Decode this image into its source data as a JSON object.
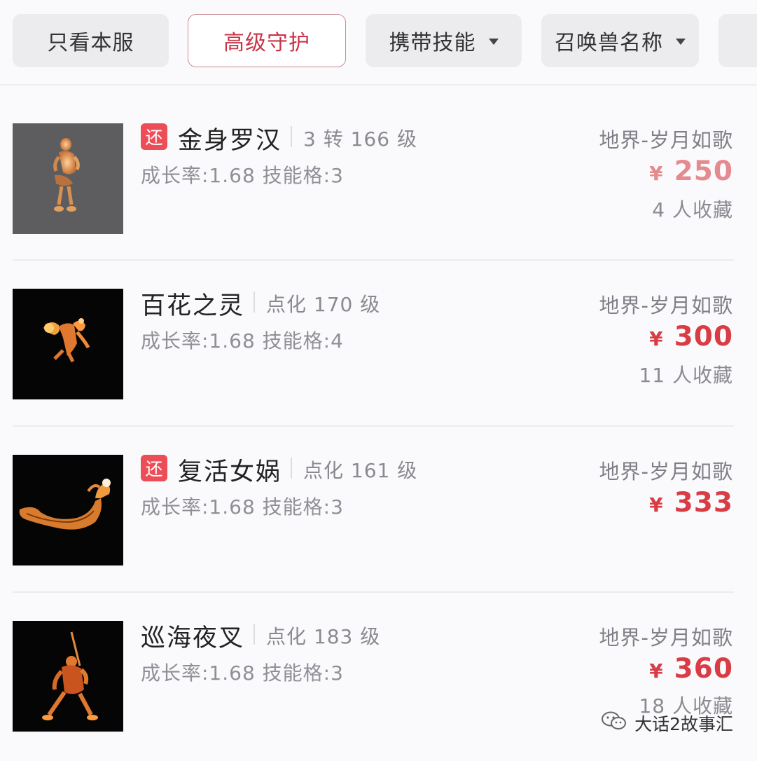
{
  "filters": [
    {
      "label": "只看本服",
      "active": false,
      "dropdown": false
    },
    {
      "label": "高级守护",
      "active": true,
      "dropdown": false
    },
    {
      "label": "携带技能",
      "active": false,
      "dropdown": true
    },
    {
      "label": "召唤兽名称",
      "active": false,
      "dropdown": true
    }
  ],
  "listings": [
    {
      "tag": "还",
      "name": "金身罗汉",
      "level": "3 转 166 级",
      "stats": "成长率:1.68 技能格:3",
      "server": "地界-岁月如歌",
      "currency": "¥",
      "price": "250",
      "favorites": "4 人收藏"
    },
    {
      "tag": "",
      "name": "百花之灵",
      "level": "点化 170 级",
      "stats": "成长率:1.68 技能格:4",
      "server": "地界-岁月如歌",
      "currency": "¥",
      "price": "300",
      "favorites": "11 人收藏"
    },
    {
      "tag": "还",
      "name": "复活女娲",
      "level": "点化 161 级",
      "stats": "成长率:1.68 技能格:3",
      "server": "地界-岁月如歌",
      "currency": "¥",
      "price": "333",
      "favorites": ""
    },
    {
      "tag": "",
      "name": "巡海夜叉",
      "level": "点化 183 级",
      "stats": "成长率:1.68 技能格:3",
      "server": "地界-岁月如歌",
      "currency": "¥",
      "price": "360",
      "favorites": "18 人收藏"
    }
  ],
  "watermark": {
    "text": "大话2故事汇",
    "icon": "wechat-icon"
  },
  "colors": {
    "accent": "#d93c45",
    "tag_bg": "#ec4d57",
    "chip_bg": "#ececef",
    "active_border": "#c98a92"
  }
}
